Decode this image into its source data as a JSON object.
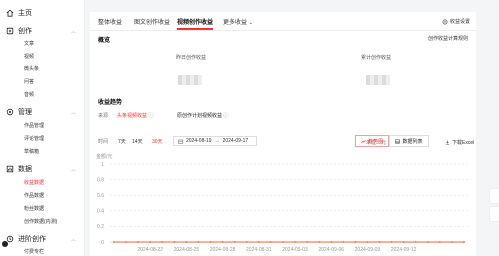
{
  "sidebar": {
    "home": "主页",
    "groups": [
      {
        "label": "创作",
        "items": [
          "文章",
          "视频",
          "微头条",
          "问答",
          "音频"
        ]
      },
      {
        "label": "管理",
        "items": [
          "作品管理",
          "评论管理",
          "草稿箱"
        ]
      },
      {
        "label": "数据",
        "items": [
          "收益数据",
          "作品数据",
          "粉丝数据",
          "创作数据(内测)"
        ]
      },
      {
        "label": "进阶创作",
        "items": [
          "付费专栏"
        ]
      }
    ],
    "active_item": "收益数据"
  },
  "tabs": [
    "整体收益",
    "图文创作收益",
    "视频创作收益",
    "更多收益"
  ],
  "active_tab": "视频创作收益",
  "settings_label": "收益设置",
  "overview": {
    "title": "概览",
    "rule_link": "创作收益计算规则",
    "yesterday_label": "昨日创作收益",
    "total_label": "累计创作收益"
  },
  "trend": {
    "title": "收益趋势",
    "source_label": "来源",
    "sources": [
      "头条视频收益",
      "原创作计划视频收益"
    ],
    "period_label": "时间",
    "periods": [
      "7天",
      "14天",
      "30天"
    ],
    "active_period": "30天",
    "date_start": "2024-08-19",
    "date_sep": "→",
    "date_end": "2024-09-17",
    "unit": "单位：元",
    "btn_chart": "趋势图",
    "btn_table": "数据列表",
    "btn_download": "下载Excel"
  },
  "chart_data": {
    "type": "line",
    "ylabel": "金额/元",
    "ylim": [
      0,
      1
    ],
    "yticks": [
      "0",
      "0.2",
      "0.4",
      "0.6",
      "0.8",
      "1"
    ],
    "xticks": [
      "2024-08-22",
      "2024-08-25",
      "2024-08-28",
      "2024-08-31",
      "2024-09-03",
      "2024-09-06",
      "2024-09-09",
      "2024-09-12"
    ],
    "series": [
      {
        "values": [
          0,
          0,
          0,
          0,
          0,
          0,
          0,
          0,
          0,
          0,
          0,
          0,
          0,
          0,
          0,
          0,
          0,
          0,
          0,
          0,
          0,
          0,
          0,
          0,
          0,
          0,
          0,
          0,
          0,
          0
        ]
      }
    ],
    "color": "#f0603c"
  }
}
